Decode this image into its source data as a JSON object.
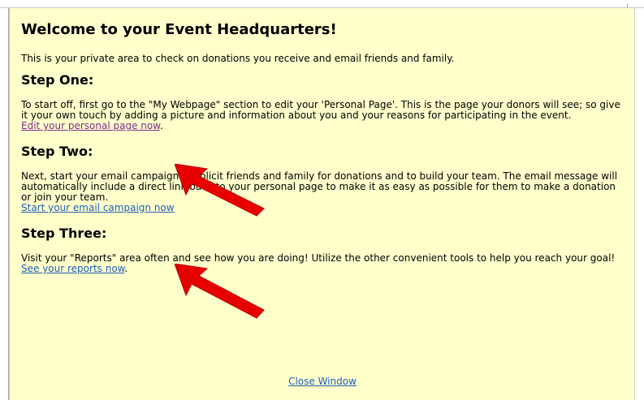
{
  "page": {
    "title": "Welcome to your Event Headquarters!",
    "intro": "This is your private area to check on donations you receive and email friends and family."
  },
  "steps": [
    {
      "heading": "Step One:",
      "body": "To start off, first go to the \"My Webpage\" section to edit your 'Personal Page'. This is the page your donors will see; so give it your own touch by adding a picture and information about you and your reasons for participating in the event.",
      "link": "Edit your personal page now",
      "suffix": "."
    },
    {
      "heading": "Step Two:",
      "body": "Next, start your email campaign to solicit friends and family for donations and to build your team. The email message will automatically include a direct link back to your personal page to make it as easy as possible for them to make a donation or join your team.",
      "link": "Start your email campaign now",
      "suffix": ""
    },
    {
      "heading": "Step Three:",
      "body": "Visit your \"Reports\" area often and see how you are doing! Utilize the other convenient tools to help you reach your goal!",
      "link": "See your reports now",
      "suffix": "."
    }
  ],
  "footer": {
    "close_label": "Close Window"
  },
  "colors": {
    "panel_background": "#ffffcc",
    "visited_link": "#7b2e8a",
    "link": "#1f5fb8",
    "arrow": "#e60000"
  },
  "annotations": [
    {
      "name": "red-arrow-icon",
      "points_to": "Edit your personal page now"
    },
    {
      "name": "red-arrow-icon",
      "points_to": "Start your email campaign now"
    }
  ]
}
